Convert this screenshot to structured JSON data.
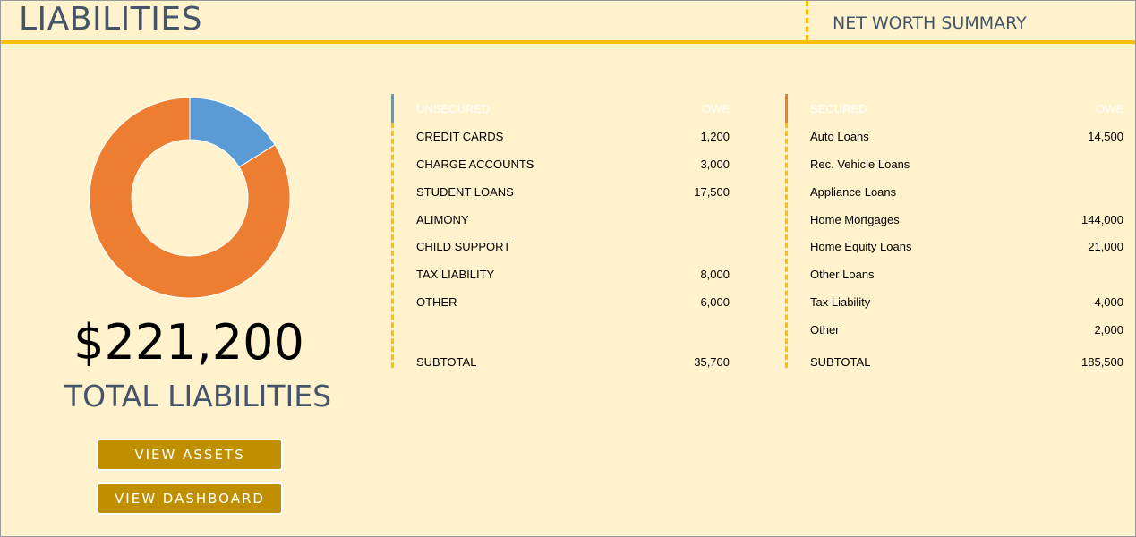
{
  "header": {
    "title": "LIABILITIES",
    "nav_link": "NET WORTH SUMMARY"
  },
  "summary": {
    "total": "$221,200",
    "label": "TOTAL LIABILITIES",
    "donut": {
      "slices": [
        {
          "name": "Unsecured",
          "value": 35700,
          "color": "#5b9bd5"
        },
        {
          "name": "Secured",
          "value": 185500,
          "color": "#ed7d31"
        }
      ]
    }
  },
  "buttons": {
    "assets": "VIEW ASSETS",
    "dashboard": "VIEW DASHBOARD"
  },
  "unsecured": {
    "accent_color": "#5b9bd5",
    "header_label": "UNSECURED",
    "header_value": "OWE",
    "rows": [
      {
        "label": "CREDIT CARDS",
        "value": "1,200"
      },
      {
        "label": "CHARGE ACCOUNTS",
        "value": "3,000"
      },
      {
        "label": "STUDENT LOANS",
        "value": "17,500"
      },
      {
        "label": "ALIMONY",
        "value": ""
      },
      {
        "label": "CHILD SUPPORT",
        "value": ""
      },
      {
        "label": "TAX LIABILITY",
        "value": "8,000"
      },
      {
        "label": "OTHER",
        "value": "6,000"
      }
    ],
    "subtotal_label": "SUBTOTAL",
    "subtotal_value": "35,700"
  },
  "secured": {
    "accent_color": "#ed7d31",
    "header_label": "SECURED",
    "header_value": "OWE",
    "rows": [
      {
        "label": "Auto Loans",
        "value": "14,500"
      },
      {
        "label": "Rec. Vehicle Loans",
        "value": ""
      },
      {
        "label": "Appliance Loans",
        "value": ""
      },
      {
        "label": "Home Mortgages",
        "value": "144,000"
      },
      {
        "label": "Home Equity Loans",
        "value": "21,000"
      },
      {
        "label": "Other Loans",
        "value": ""
      },
      {
        "label": "Tax Liability",
        "value": "4,000"
      },
      {
        "label": "Other",
        "value": "2,000"
      }
    ],
    "subtotal_label": "SUBTOTAL",
    "subtotal_value": "185,500"
  }
}
